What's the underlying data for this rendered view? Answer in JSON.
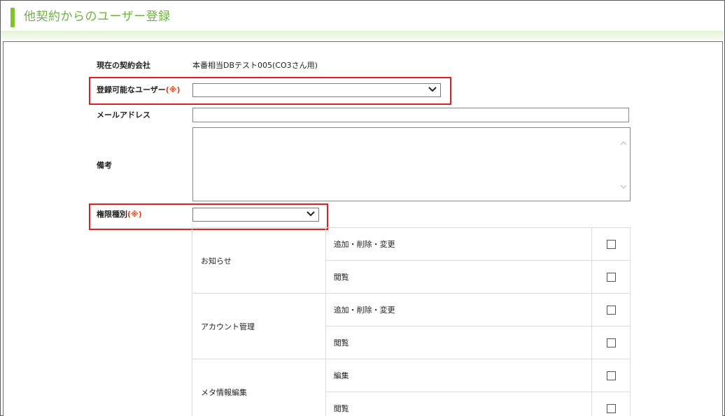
{
  "page": {
    "title": "他契約からのユーザー登録"
  },
  "form": {
    "current_contract": {
      "label": "現在の契約会社",
      "value": "本番相当DBテスト005(CO3さん用)"
    },
    "registrable_user": {
      "label": "登録可能なユーザー",
      "required_mark": "(※)",
      "value": ""
    },
    "email": {
      "label": "メールアドレス",
      "value": ""
    },
    "remarks": {
      "label": "備考",
      "value": ""
    },
    "permission_type": {
      "label": "権限種別",
      "required_mark": "(※)",
      "value": ""
    }
  },
  "permissions": [
    {
      "category": "お知らせ",
      "actions": [
        {
          "label": "追加・削除・変更",
          "checked": false
        },
        {
          "label": "閲覧",
          "checked": false
        }
      ]
    },
    {
      "category": "アカウント管理",
      "actions": [
        {
          "label": "追加・削除・変更",
          "checked": false
        },
        {
          "label": "閲覧",
          "checked": false
        }
      ]
    },
    {
      "category": "メタ情報編集",
      "actions": [
        {
          "label": "編集",
          "checked": false
        },
        {
          "label": "閲覧",
          "checked": false
        }
      ]
    }
  ],
  "colors": {
    "accent_green": "#7cc42a",
    "title_green": "#6db33f",
    "required_red": "#e0401a",
    "highlight_red": "#e02020"
  }
}
